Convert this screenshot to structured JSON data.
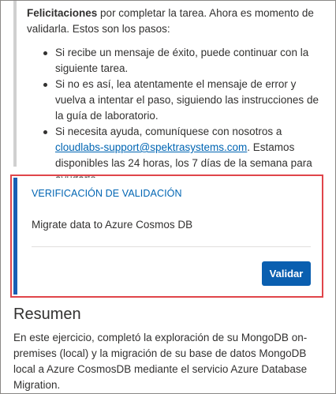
{
  "instructions": {
    "intro_bold": "Felicitaciones",
    "intro_rest": " por completar la tarea. Ahora es momento de validarla. Estos son los pasos:",
    "steps": [
      {
        "text": "Si recibe un mensaje de éxito, puede continuar con la siguiente tarea."
      },
      {
        "text": "Si no es así, lea atentamente el mensaje de error y vuelva a intentar el paso, siguiendo las instrucciones de la guía de laboratorio."
      },
      {
        "text_before": "Si necesita ayuda, comuníquese con nosotros a ",
        "link": "cloudlabs-support@spektrasystems.com",
        "text_after": ". Estamos disponibles las 24 horas, los 7 días de la semana para ayudarlo."
      }
    ]
  },
  "validation": {
    "heading": "VERIFICACIÓN DE VALIDACIÓN",
    "task": "Migrate data to Azure Cosmos DB",
    "button_label": "Validar",
    "accent_color": "#1a5fb4",
    "highlight_color": "#e0454a"
  },
  "summary": {
    "title": "Resumen",
    "text": "En este ejercicio, completó la exploración de su MongoDB on-premises (local) y la migración de su base de datos MongoDB local a Azure CosmosDB mediante el servicio Azure Database Migration."
  }
}
